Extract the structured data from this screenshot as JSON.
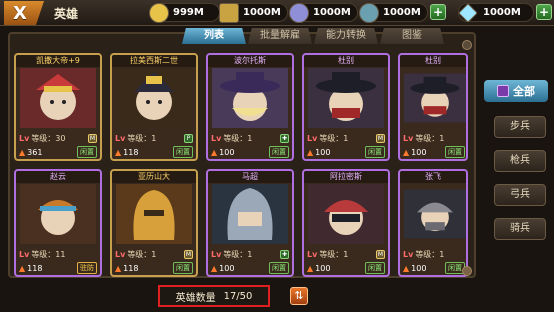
{
  "header": {
    "close_label": "X",
    "title": "英雄",
    "resources": [
      {
        "name": "gold",
        "icon": "coin-icon",
        "value": "999M",
        "color": "#e8c34a"
      },
      {
        "name": "ore",
        "icon": "ore-icon",
        "value": "1000M",
        "color": "#c9a241"
      },
      {
        "name": "stone",
        "icon": "stone-icon",
        "value": "1000M",
        "color": "#8f8fd8"
      },
      {
        "name": "food",
        "icon": "food-icon",
        "value": "1000M",
        "color": "#6aa0b0"
      },
      {
        "name": "diamond",
        "icon": "diamond-icon",
        "value": "1000M",
        "color": "#9ee6ff"
      }
    ],
    "plus_label": "+"
  },
  "tabs": [
    {
      "label": "列表",
      "active": true
    },
    {
      "label": "批量解雇",
      "active": false
    },
    {
      "label": "能力转换",
      "active": false
    },
    {
      "label": "图鉴",
      "active": false
    }
  ],
  "heroes": [
    {
      "name": "凯撒大帝+9",
      "rarity": "gold",
      "level_label": "Lv",
      "level_text": "等级：30",
      "power": "361",
      "status": "闲置"
    },
    {
      "name": "拉美西斯二世",
      "rarity": "gold",
      "level_label": "Lv",
      "level_text": "等级：1",
      "power": "118",
      "status": "闲置"
    },
    {
      "name": "波尔托斯",
      "rarity": "purple",
      "level_label": "Lv",
      "level_text": "等级：1",
      "power": "100",
      "status": "闲置"
    },
    {
      "name": "杜别",
      "rarity": "purple",
      "level_label": "Lv",
      "level_text": "等级：1",
      "power": "100",
      "status": "闲置"
    },
    {
      "name": "杜别",
      "rarity": "purple",
      "level_label": "Lv",
      "level_text": "等级：1",
      "power": "100",
      "status": "闲置"
    },
    {
      "name": "赵云",
      "rarity": "purple",
      "level_label": "Lv",
      "level_text": "等级：11",
      "power": "118",
      "status": "驻防"
    },
    {
      "name": "亚历山大",
      "rarity": "gold",
      "level_label": "Lv",
      "level_text": "等级：1",
      "power": "118",
      "status": "闲置"
    },
    {
      "name": "马超",
      "rarity": "purple",
      "level_label": "Lv",
      "level_text": "等级：1",
      "power": "100",
      "status": "闲置"
    },
    {
      "name": "阿拉密斯",
      "rarity": "purple",
      "level_label": "Lv",
      "level_text": "等级：1",
      "power": "100",
      "status": "闲置"
    },
    {
      "name": "张飞",
      "rarity": "purple",
      "level_label": "Lv",
      "level_text": "等级：1",
      "power": "100",
      "status": "闲置"
    }
  ],
  "sidebar": {
    "all_label": "全部",
    "filters": [
      "步兵",
      "枪兵",
      "弓兵",
      "骑兵"
    ]
  },
  "footer": {
    "count_label": "英雄数量",
    "count_value": "17/50"
  },
  "colors": {
    "accent": "#2b6f93",
    "gold_border": "#c7a04f",
    "purple_border": "#b06fe0",
    "highlight": "#e02020"
  }
}
